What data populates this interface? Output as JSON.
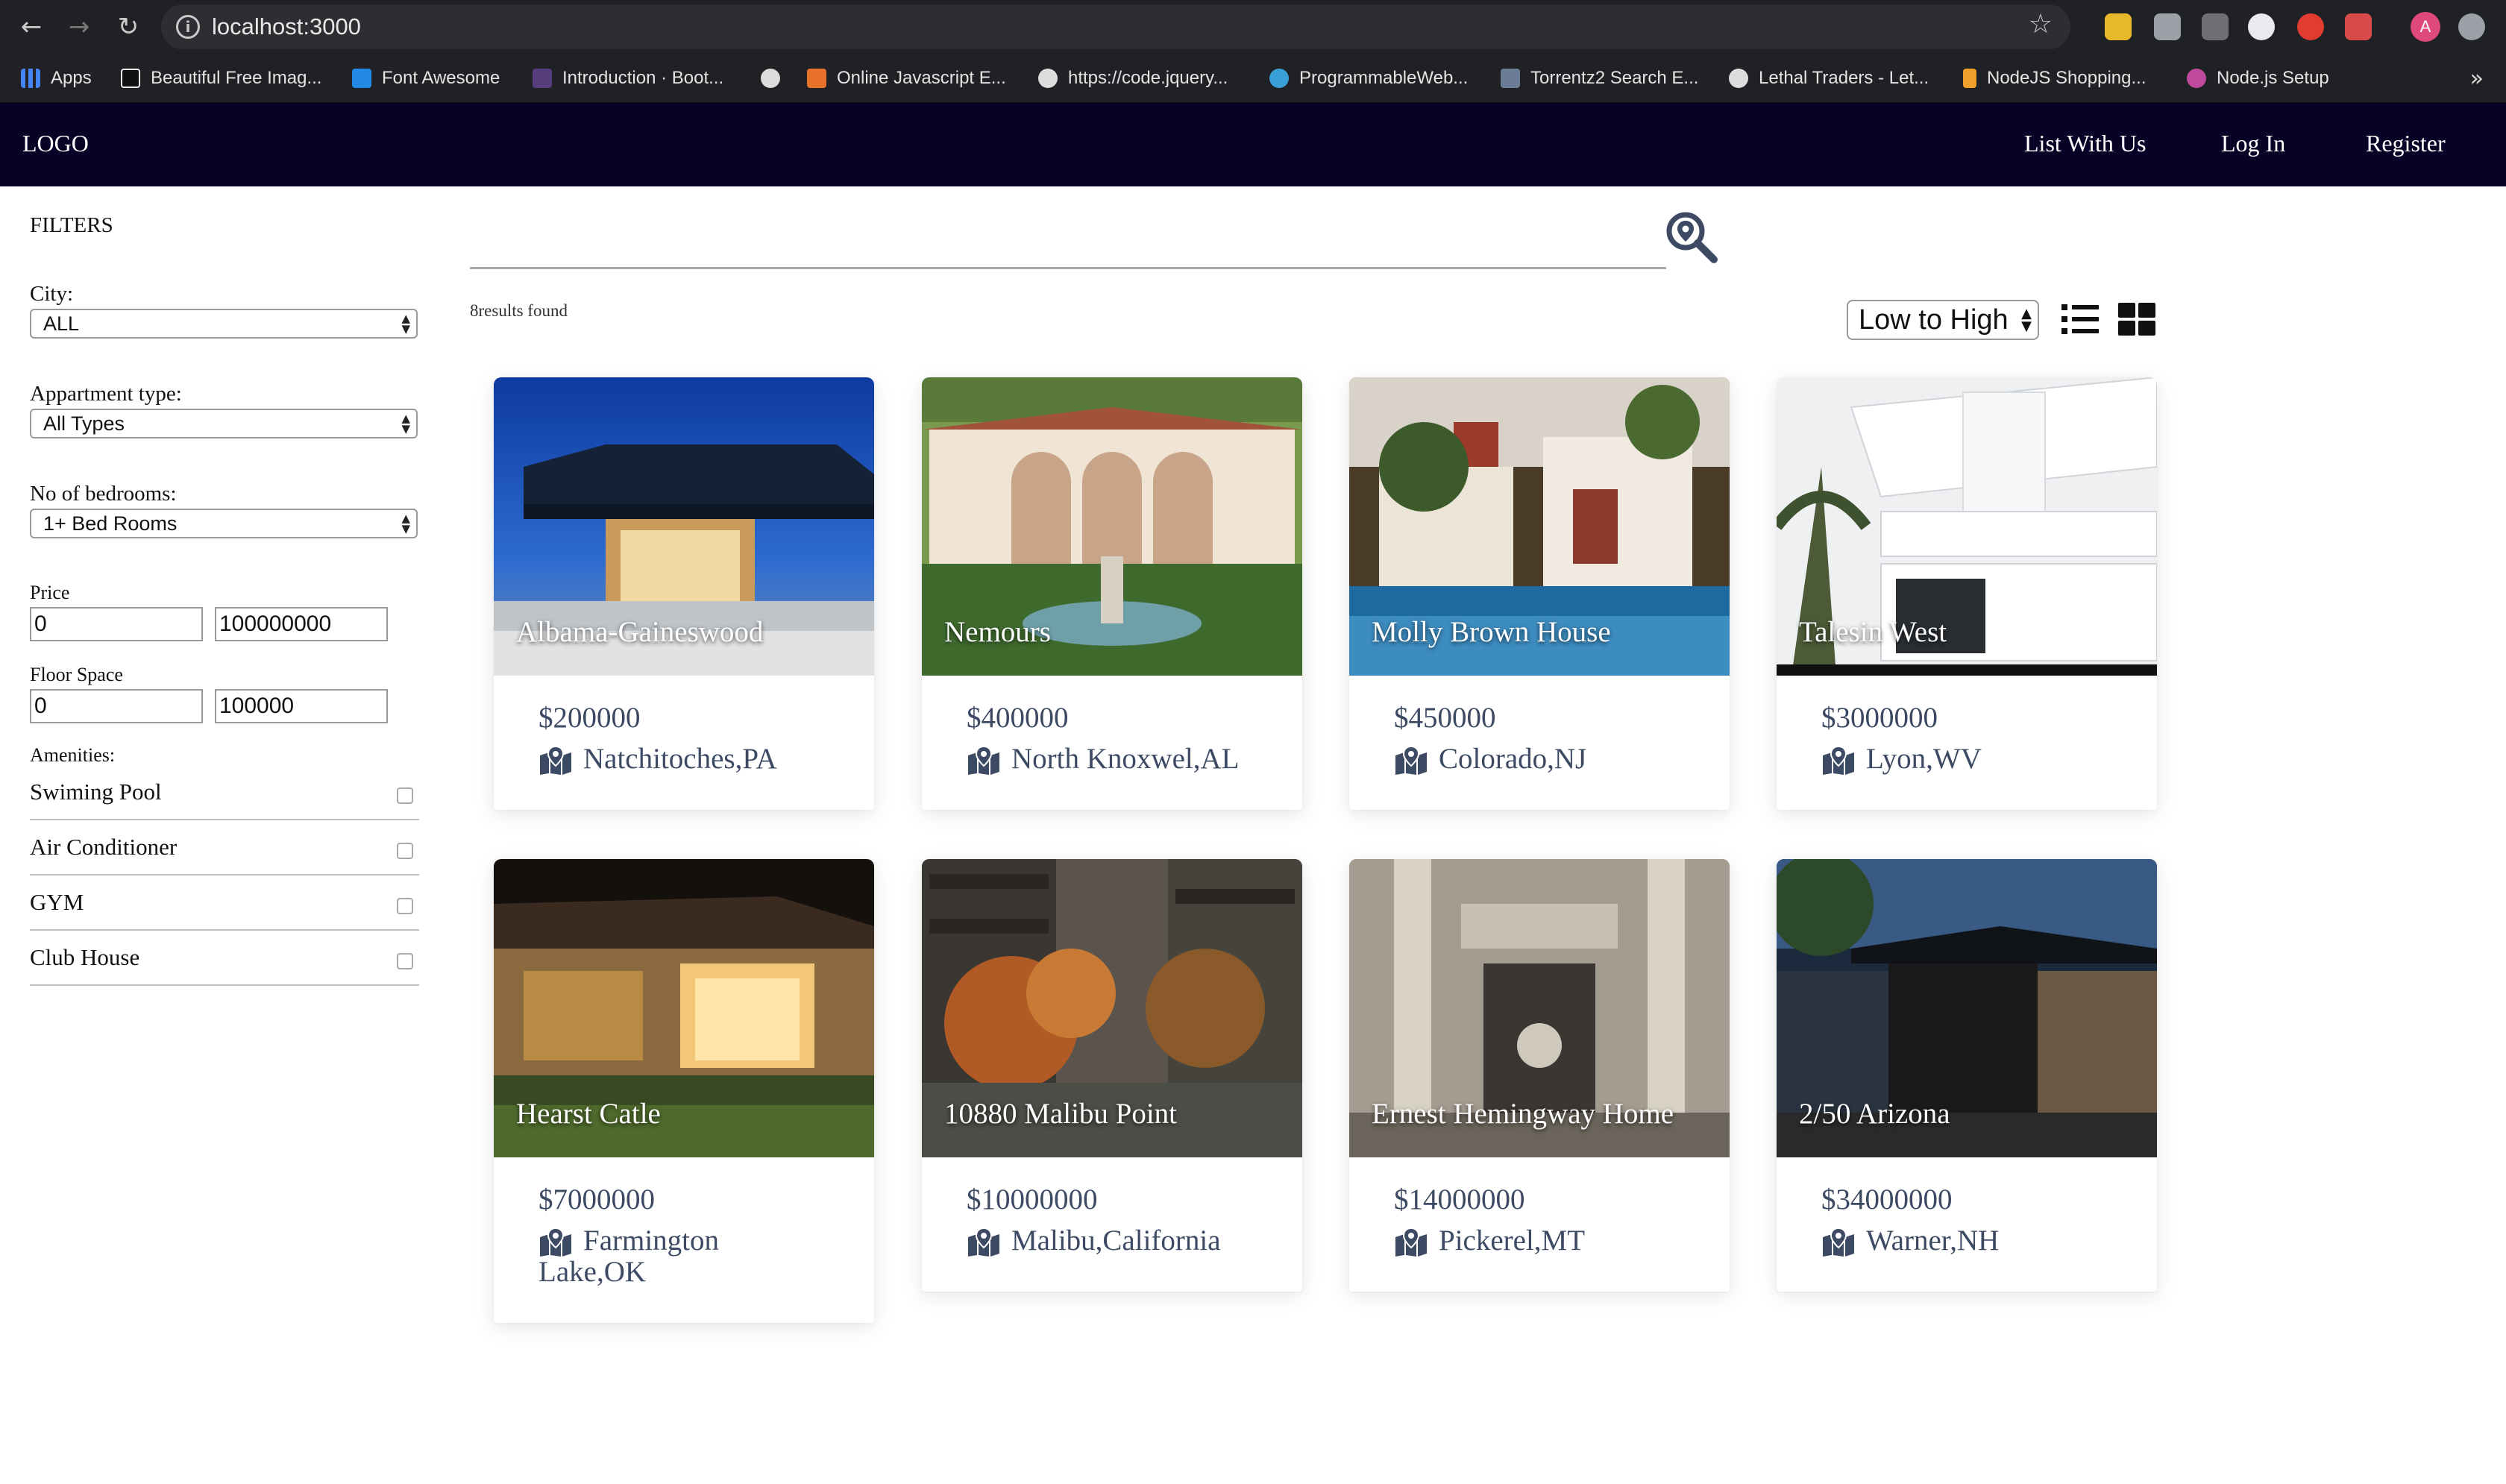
{
  "browser": {
    "url": "localhost:3000",
    "bookmarks": [
      {
        "label": "Apps",
        "color": "#4285f4"
      },
      {
        "label": "Beautiful Free Imag...",
        "color": "#111111"
      },
      {
        "label": "Font Awesome",
        "color": "#228ae6"
      },
      {
        "label": "Introduction · Boot...",
        "color": "#563d7c"
      },
      {
        "label": "",
        "color": "#dddddd"
      },
      {
        "label": "Online Javascript E...",
        "color": "#e8712c"
      },
      {
        "label": "https://code.jquery...",
        "color": "#dddddd"
      },
      {
        "label": "ProgrammableWeb...",
        "color": "#3aa0d8"
      },
      {
        "label": "Torrentz2 Search E...",
        "color": "#6a7c96"
      },
      {
        "label": "Lethal Traders - Let...",
        "color": "#dddddd"
      },
      {
        "label": "NodeJS Shopping...",
        "color": "#f0a02a"
      },
      {
        "label": "Node.js Setup",
        "color": "#c04b9e"
      }
    ],
    "more": "»",
    "profile_initial": "A"
  },
  "header": {
    "logo": "LOGO",
    "nav": [
      "List With Us",
      "Log In",
      "Register"
    ]
  },
  "filters": {
    "title": "FILTERS",
    "city_label": "City:",
    "city_value": "ALL",
    "type_label": "Appartment type:",
    "type_value": "All Types",
    "bedrooms_label": "No of bedrooms:",
    "bedrooms_value": "1+ Bed Rooms",
    "price_label": "Price",
    "price_min": "0",
    "price_max": "100000000",
    "floor_label": "Floor Space",
    "floor_min": "0",
    "floor_max": "100000",
    "amenities_label": "Amenities:",
    "amenities": [
      "Swiming Pool",
      "Air Conditioner",
      "GYM",
      "Club House"
    ]
  },
  "search": {
    "results_text": "8results found",
    "sort_value": "Low to High"
  },
  "listings": [
    {
      "title": "Albama-Gaineswood",
      "price": "$200000",
      "location": "Natchitoches,PA"
    },
    {
      "title": "Nemours",
      "price": "$400000",
      "location": "North Knoxwel,AL"
    },
    {
      "title": "Molly Brown House",
      "price": "$450000",
      "location": "Colorado,NJ"
    },
    {
      "title": "Talesin West",
      "price": "$3000000",
      "location": "Lyon,WV"
    },
    {
      "title": "Hearst Catle",
      "price": "$7000000",
      "location": "Farmington Lake,OK"
    },
    {
      "title": "10880 Malibu Point",
      "price": "$10000000",
      "location": "Malibu,California"
    },
    {
      "title": "Ernest Hemingway Home",
      "price": "$14000000",
      "location": "Pickerel,MT"
    },
    {
      "title": "2/50 Arizona",
      "price": "$34000000",
      "location": "Warner,NH"
    }
  ],
  "colors": {
    "header_bg": "#0a0127",
    "text_accent": "#3c4a64"
  }
}
